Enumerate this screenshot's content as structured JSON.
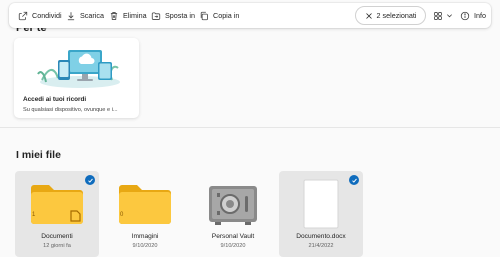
{
  "toolbar": {
    "share_label": "Condividi",
    "download_label": "Scarica",
    "delete_label": "Elimina",
    "move_label": "Sposta in",
    "copy_label": "Copia in",
    "selection_label": "2 selezionati",
    "info_label": "Info",
    "accent_color": "#0f6cbd"
  },
  "top_section": {
    "heading_partial": "Per te",
    "card": {
      "title": "Accedi ai tuoi ricordi",
      "subtitle": "Su qualsiasi dispositivo, ovunque e i..."
    }
  },
  "files_section": {
    "title": "I miei file",
    "items": [
      {
        "name": "Documenti",
        "meta": "12 giorni fa",
        "count": "1",
        "icon": "folder-icon",
        "selected": true
      },
      {
        "name": "Immagini",
        "meta": "9/10/2020",
        "count": "0",
        "icon": "folder-icon",
        "selected": false
      },
      {
        "name": "Personal Vault",
        "meta": "9/10/2020",
        "icon": "vault-icon",
        "selected": false
      },
      {
        "name": "Documento.docx",
        "meta": "21/4/2022",
        "icon": "document-icon",
        "selected": true
      }
    ]
  }
}
